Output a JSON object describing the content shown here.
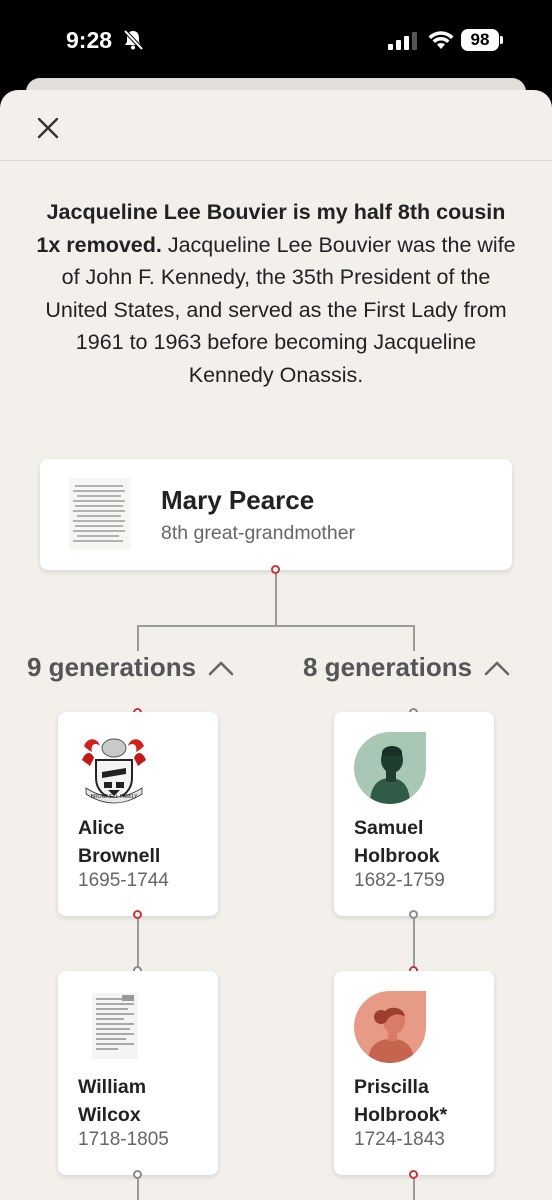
{
  "status": {
    "time": "9:28",
    "battery": "98"
  },
  "description": {
    "bold": "Jacqueline Lee Bouvier is my half 8th cousin 1x removed.",
    "text": " Jacqueline Lee Bouvier was the wife of John F. Kennedy, the 35th President of the United States, and served as the First Lady from 1961 to 1963 before becoming Jacqueline Kennedy Onassis."
  },
  "root": {
    "name": "Mary Pearce",
    "relation": "8th great-grandmother"
  },
  "branches": [
    {
      "generations": "9 generations",
      "people": [
        {
          "first": "Alice",
          "last": "Brownell",
          "years": "1695-1744",
          "image": "coat-of-arms"
        },
        {
          "first": "William",
          "last": "Wilcox",
          "years": "1718-1805",
          "image": "document"
        }
      ]
    },
    {
      "generations": "8 generations",
      "people": [
        {
          "first": "Samuel",
          "last": "Holbrook",
          "years": "1682-1759",
          "image": "male-silhouette"
        },
        {
          "first": "Priscilla",
          "last": "Holbrook*",
          "years": "1724-1843",
          "image": "female-silhouette"
        }
      ]
    }
  ],
  "colors": {
    "background": "#f3f0ec",
    "accent_red": "#c8333a",
    "male_avatar": "#a9c7b5",
    "female_avatar": "#e79a86"
  }
}
